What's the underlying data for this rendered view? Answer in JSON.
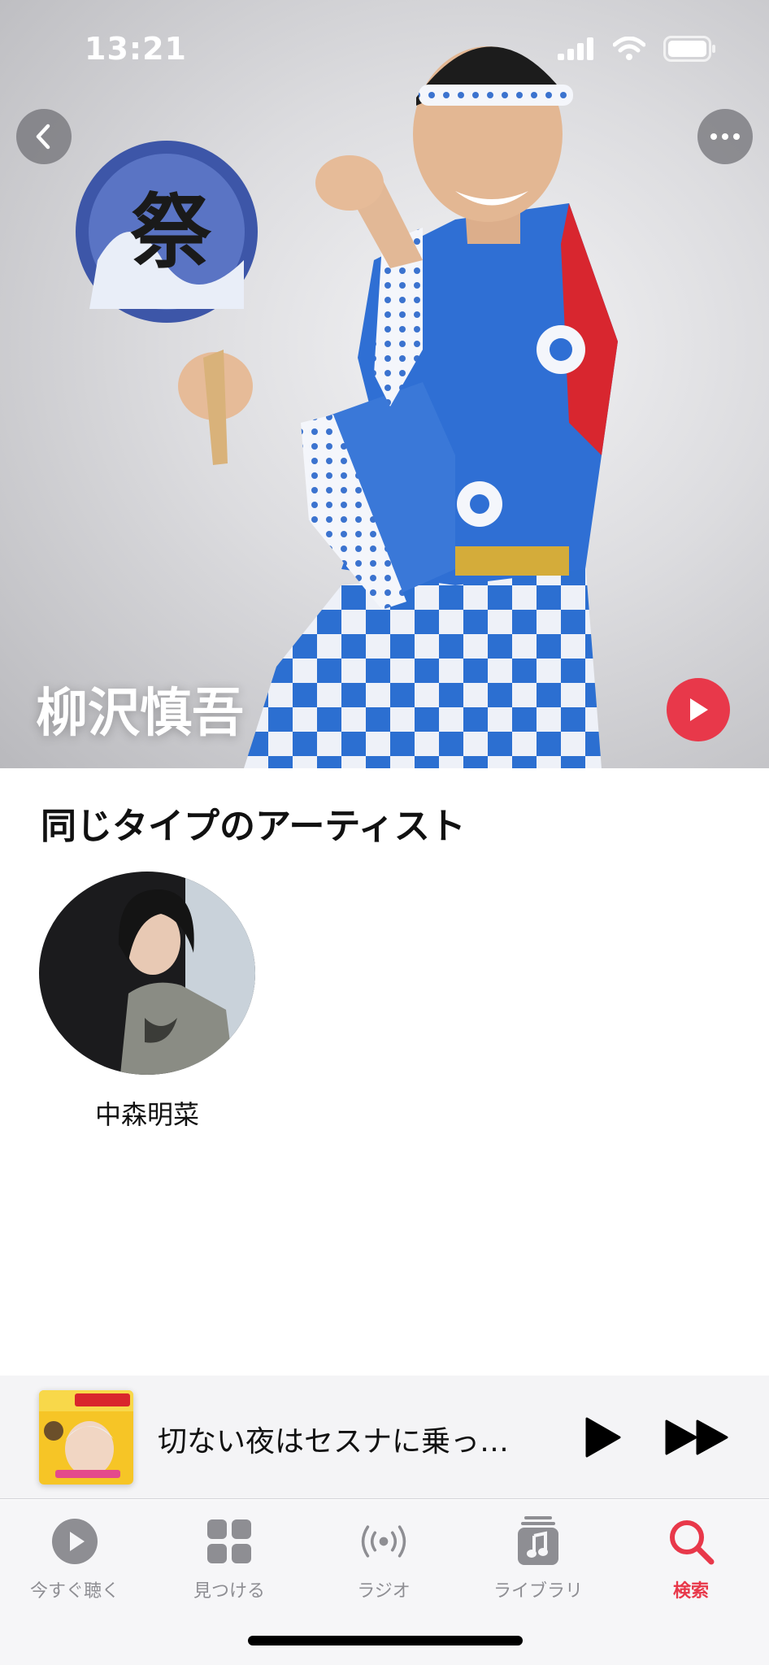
{
  "status_bar": {
    "time": "13:21"
  },
  "hero": {
    "artist_name": "柳沢慎吾",
    "fan_glyph": "祭"
  },
  "similar_artists": {
    "title": "同じタイプのアーティスト",
    "items": [
      {
        "name": "中森明菜"
      }
    ]
  },
  "now_playing": {
    "title": "切ない夜はセスナに乗っ…"
  },
  "tab_bar": {
    "tabs": [
      {
        "label": "今すぐ聴く",
        "icon": "play-circle-icon",
        "active": false
      },
      {
        "label": "見つける",
        "icon": "grid-icon",
        "active": false
      },
      {
        "label": "ラジオ",
        "icon": "radio-waves-icon",
        "active": false
      },
      {
        "label": "ライブラリ",
        "icon": "music-note-stack-icon",
        "active": false
      },
      {
        "label": "検索",
        "icon": "search-icon",
        "active": true
      }
    ]
  },
  "colors": {
    "accent": "#e8384a",
    "tab_inactive": "#8e8e93"
  }
}
